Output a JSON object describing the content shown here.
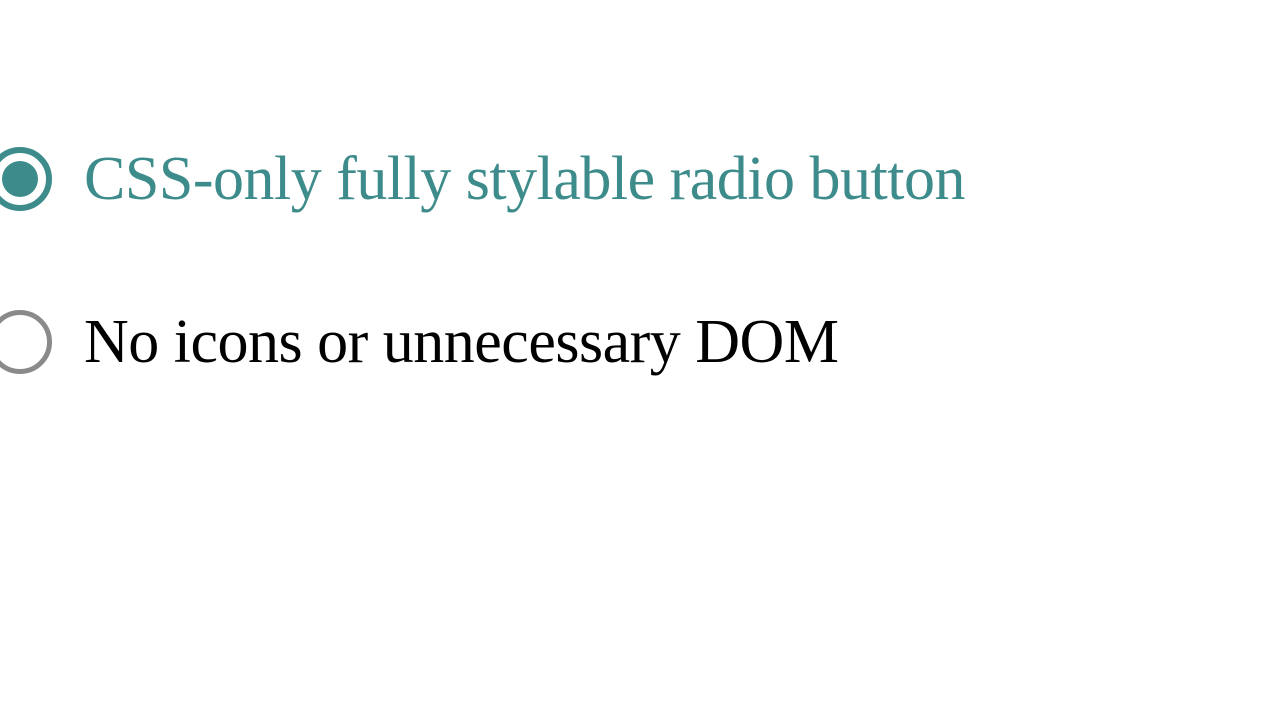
{
  "colors": {
    "accent": "#3d8b8b",
    "unchecked_border": "#8a8a8a",
    "text_default": "#000000"
  },
  "radios": {
    "option1": {
      "label": "CSS-only fully stylable radio button",
      "checked": true
    },
    "option2": {
      "label": "No icons or unnecessary DOM",
      "checked": false
    }
  }
}
